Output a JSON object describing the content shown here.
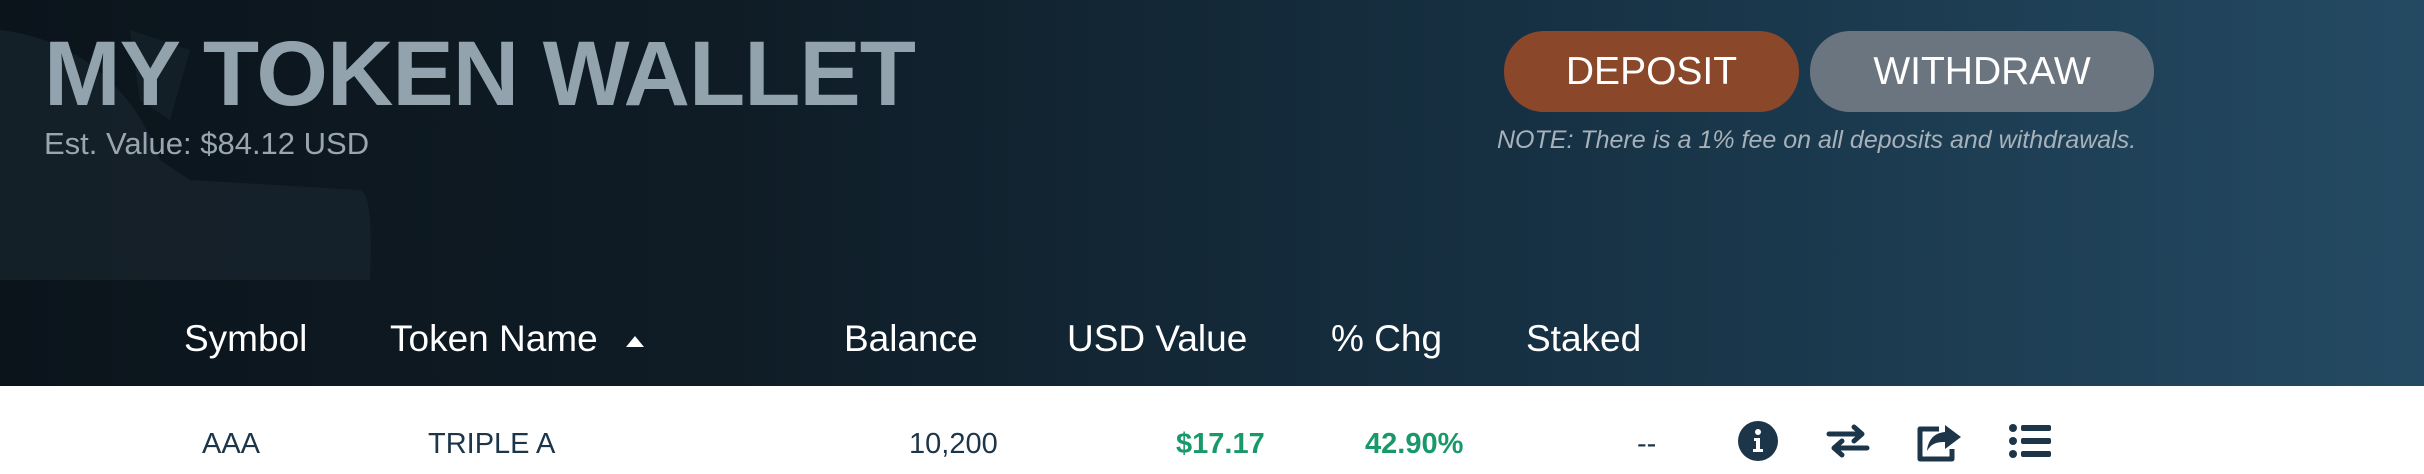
{
  "header": {
    "title": "MY TOKEN WALLET",
    "est_value": "Est. Value: $84.12 USD",
    "deposit_label": "DEPOSIT",
    "withdraw_label": "WITHDRAW",
    "note": "NOTE: There is a 1% fee on all deposits and withdrawals."
  },
  "table": {
    "columns": [
      "Symbol",
      "Token Name",
      "Balance",
      "USD Value",
      "% Chg",
      "Staked"
    ],
    "sort_column": "Token Name",
    "sort_direction": "ascending",
    "rows": [
      {
        "symbol": "AAA",
        "name": "TRIPLE A",
        "balance": "10,200",
        "usd_value": "$17.17",
        "pct_chg": "42.90%",
        "staked": "--",
        "actions": [
          "info-icon",
          "transfer-icon",
          "share-icon",
          "list-icon"
        ]
      }
    ]
  },
  "colors": {
    "deposit": "#8b472a",
    "withdraw": "#6b757f",
    "positive": "#19996a",
    "text_dark": "#1c3548"
  }
}
